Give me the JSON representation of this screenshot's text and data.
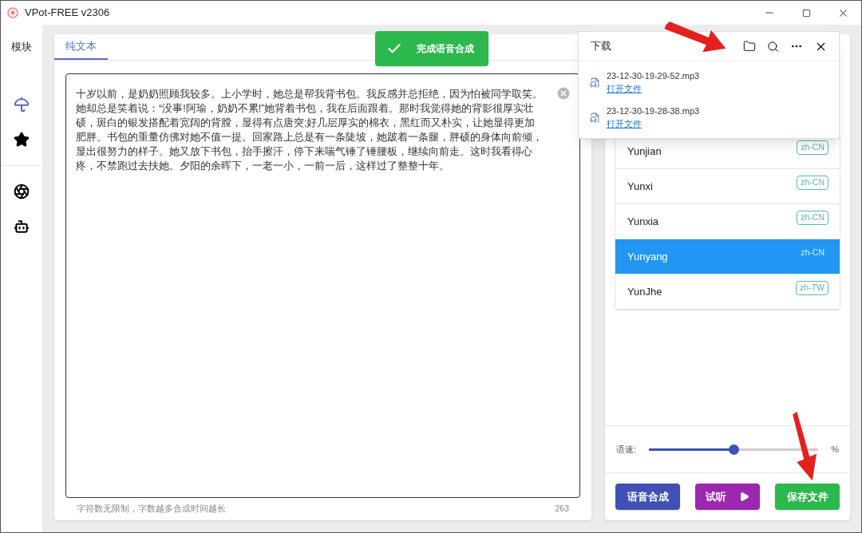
{
  "window": {
    "title": "VPot-FREE v2306"
  },
  "sidebar": {
    "heading": "模块",
    "items": [
      {
        "kind": "umbrella",
        "selected": true
      },
      {
        "kind": "star",
        "selected": false
      },
      {
        "kind": "aperture",
        "selected": false
      },
      {
        "kind": "android",
        "selected": false
      }
    ]
  },
  "tabs": [
    {
      "label": "纯文本",
      "selected": true
    }
  ],
  "editor": {
    "value": "十岁以前，是奶奶照顾我较多。上小学时，她总是帮我背书包。我反感并总拒绝，因为怕被同学取笑。她却总是笑着说：“没事!阿瑜，奶奶不累!”她背着书包，我在后面跟着。那时我觉得她的背影很厚实壮硕，斑白的银发搭配着宽阔的背膛，显得有点唐突;好几层厚实的棉衣，黑红而又朴实，让她显得更加肥胖。书包的重量仿佛对她不值一提。回家路上总是有一条陡坡，她跛着一条腿，胖硕的身体向前倾，显出很努力的样子。她又放下书包，抬手擦汗，停下来喘气锤了锤腰板，继续向前走。这时我看得心疼，不禁跑过去扶她。夕阳的余晖下，一老一小，一前一后，这样过了整整十年。",
    "hint": "字符数无限制，字数越多合成时间越长",
    "count": "263"
  },
  "toast": {
    "text": "完成语音合成"
  },
  "downloads": {
    "title": "下载",
    "items": [
      {
        "file": "23-12-30-19-29-52.mp3",
        "link": "打开文件"
      },
      {
        "file": "23-12-30-19-28-38.mp3",
        "link": "打开文件"
      }
    ]
  },
  "voices": [
    {
      "name": "Yunjian",
      "locale": "zh-CN",
      "selected": false
    },
    {
      "name": "Yunxi",
      "locale": "zh-CN",
      "selected": false
    },
    {
      "name": "Yunxia",
      "locale": "zh-CN",
      "selected": false
    },
    {
      "name": "Yunyang",
      "locale": "zh-CN",
      "selected": true
    },
    {
      "name": "YunJhe",
      "locale": "zh-TW",
      "selected": false
    }
  ],
  "speed": {
    "label": "语速:",
    "level": 0.5,
    "unit": "%"
  },
  "buttons": [
    {
      "kind": "synth",
      "label": "语音合成"
    },
    {
      "kind": "listen",
      "label": "试听"
    },
    {
      "kind": "save",
      "label": "保存文件"
    }
  ]
}
